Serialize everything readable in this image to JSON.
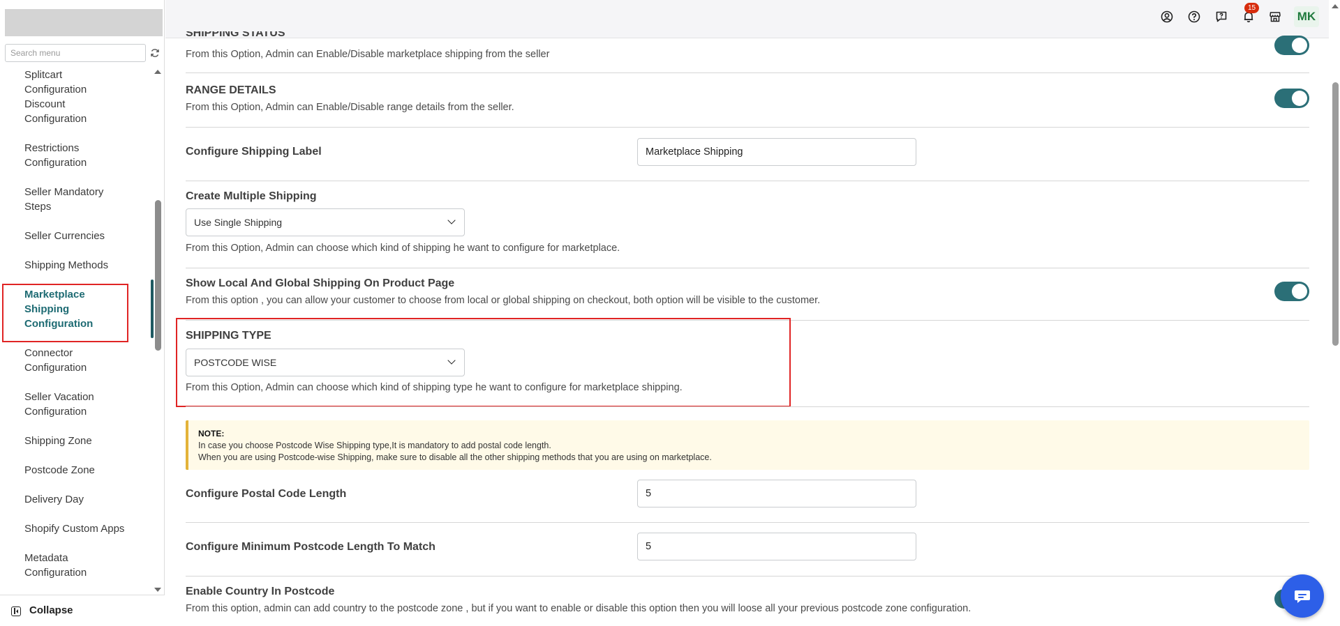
{
  "sidebar": {
    "search_placeholder": "Search menu",
    "items": [
      {
        "label": "Splitcart Configuration"
      },
      {
        "label": "Discount Configuration"
      },
      {
        "label": "Restrictions Configuration"
      },
      {
        "label": "Seller Mandatory Steps"
      },
      {
        "label": "Seller Currencies"
      },
      {
        "label": "Shipping Methods"
      },
      {
        "label": "Marketplace Shipping Configuration",
        "active": true
      },
      {
        "label": "Connector Configuration"
      },
      {
        "label": "Seller Vacation Configuration"
      },
      {
        "label": "Shipping Zone"
      },
      {
        "label": "Postcode Zone"
      },
      {
        "label": "Delivery Day"
      },
      {
        "label": "Shopify Custom Apps"
      },
      {
        "label": "Metadata Configuration"
      }
    ],
    "collapse_label": "Collapse"
  },
  "topbar": {
    "icons": [
      "user-circle-icon",
      "help-circle-icon",
      "chat-question-icon",
      "bell-icon",
      "store-icon"
    ],
    "notification_count": "15",
    "avatar_initials": "MK"
  },
  "settings": {
    "shipping_status": {
      "title": "SHIPPING STATUS",
      "desc": "From this Option, Admin can Enable/Disable marketplace shipping from the seller",
      "enabled": true
    },
    "range_details": {
      "title": "RANGE DETAILS",
      "desc": "From this Option, Admin can Enable/Disable range details from the seller.",
      "enabled": true
    },
    "shipping_label": {
      "title": "Configure Shipping Label",
      "value": "Marketplace Shipping"
    },
    "multiple_shipping": {
      "title": "Create Multiple Shipping",
      "selected": "Use Single Shipping",
      "desc": "From this Option, Admin can choose which kind of shipping he want to configure for marketplace."
    },
    "local_global": {
      "title": "Show Local And Global Shipping On Product Page",
      "desc": "From this option , you can allow your customer to choose from local or global shipping on checkout, both option will be visible to the customer.",
      "enabled": true
    },
    "shipping_type": {
      "title": "SHIPPING TYPE",
      "selected": "POSTCODE WISE",
      "desc": "From this Option, Admin can choose which kind of shipping type he want to configure for marketplace shipping."
    },
    "note": {
      "title": "NOTE:",
      "line1": "In case you choose Postcode Wise Shipping type,It is mandatory to add postal code length.",
      "line2": "When you are using Postcode-wise Shipping, make sure to disable all the other shipping methods that you are using on marketplace."
    },
    "postal_code_length": {
      "title": "Configure Postal Code Length",
      "value": "5"
    },
    "min_postcode_length": {
      "title": "Configure Minimum Postcode Length To Match",
      "value": "5"
    },
    "country_in_postcode": {
      "title": "Enable Country In Postcode",
      "desc": "From this option, admin can add country to the postcode zone , but if you want to enable or disable this option then you will loose all your previous postcode zone configuration.",
      "enabled": true
    }
  },
  "colors": {
    "toggle_on": "#2b6f77",
    "active_menu": "#1e6b73",
    "highlight_border": "#e02424",
    "note_accent": "#e3b339",
    "chat_button": "#2d5fe8"
  }
}
